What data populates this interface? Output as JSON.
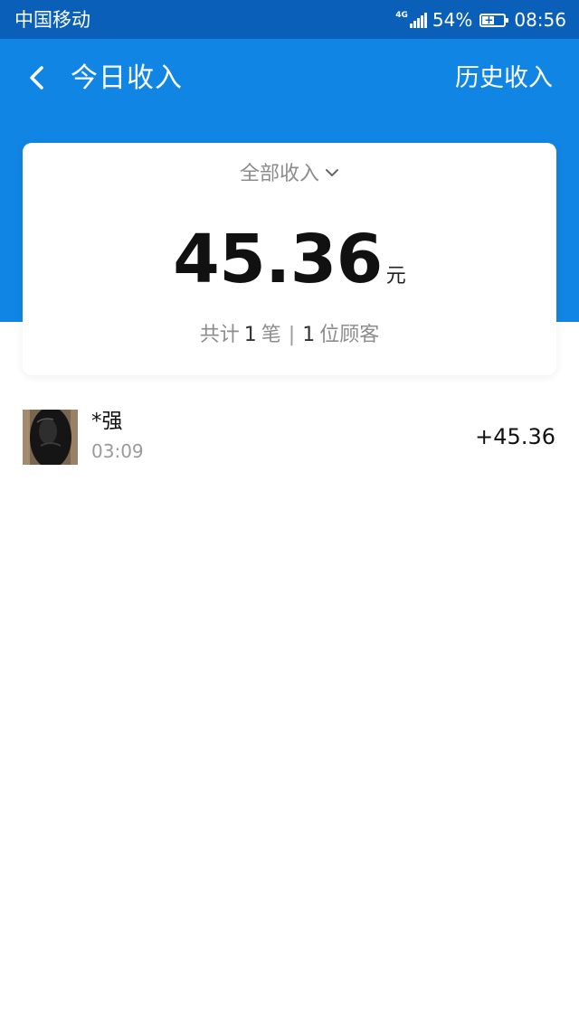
{
  "status_bar": {
    "carrier": "中国移动",
    "network_type": "4G",
    "battery_percent": "54%",
    "time": "08:56"
  },
  "header": {
    "back_icon": "chevron-left-icon",
    "title": "今日收入",
    "history_label": "历史收入"
  },
  "summary": {
    "filter_label": "全部收入",
    "filter_icon": "chevron-down-icon",
    "amount": "45.36",
    "unit": "元",
    "totals_prefix": "共计",
    "count_transactions": "1",
    "transactions_suffix": "笔",
    "separator": "|",
    "count_customers": "1",
    "customers_suffix": "位顾客"
  },
  "transactions": [
    {
      "name": "*强",
      "time": "03:09",
      "amount": "+45.36"
    }
  ],
  "colors": {
    "status_bar_bg": "#0a5fb8",
    "header_bg": "#1185e4",
    "card_bg": "#ffffff",
    "secondary_text": "#8c8c8c",
    "primary_text": "#111111"
  }
}
